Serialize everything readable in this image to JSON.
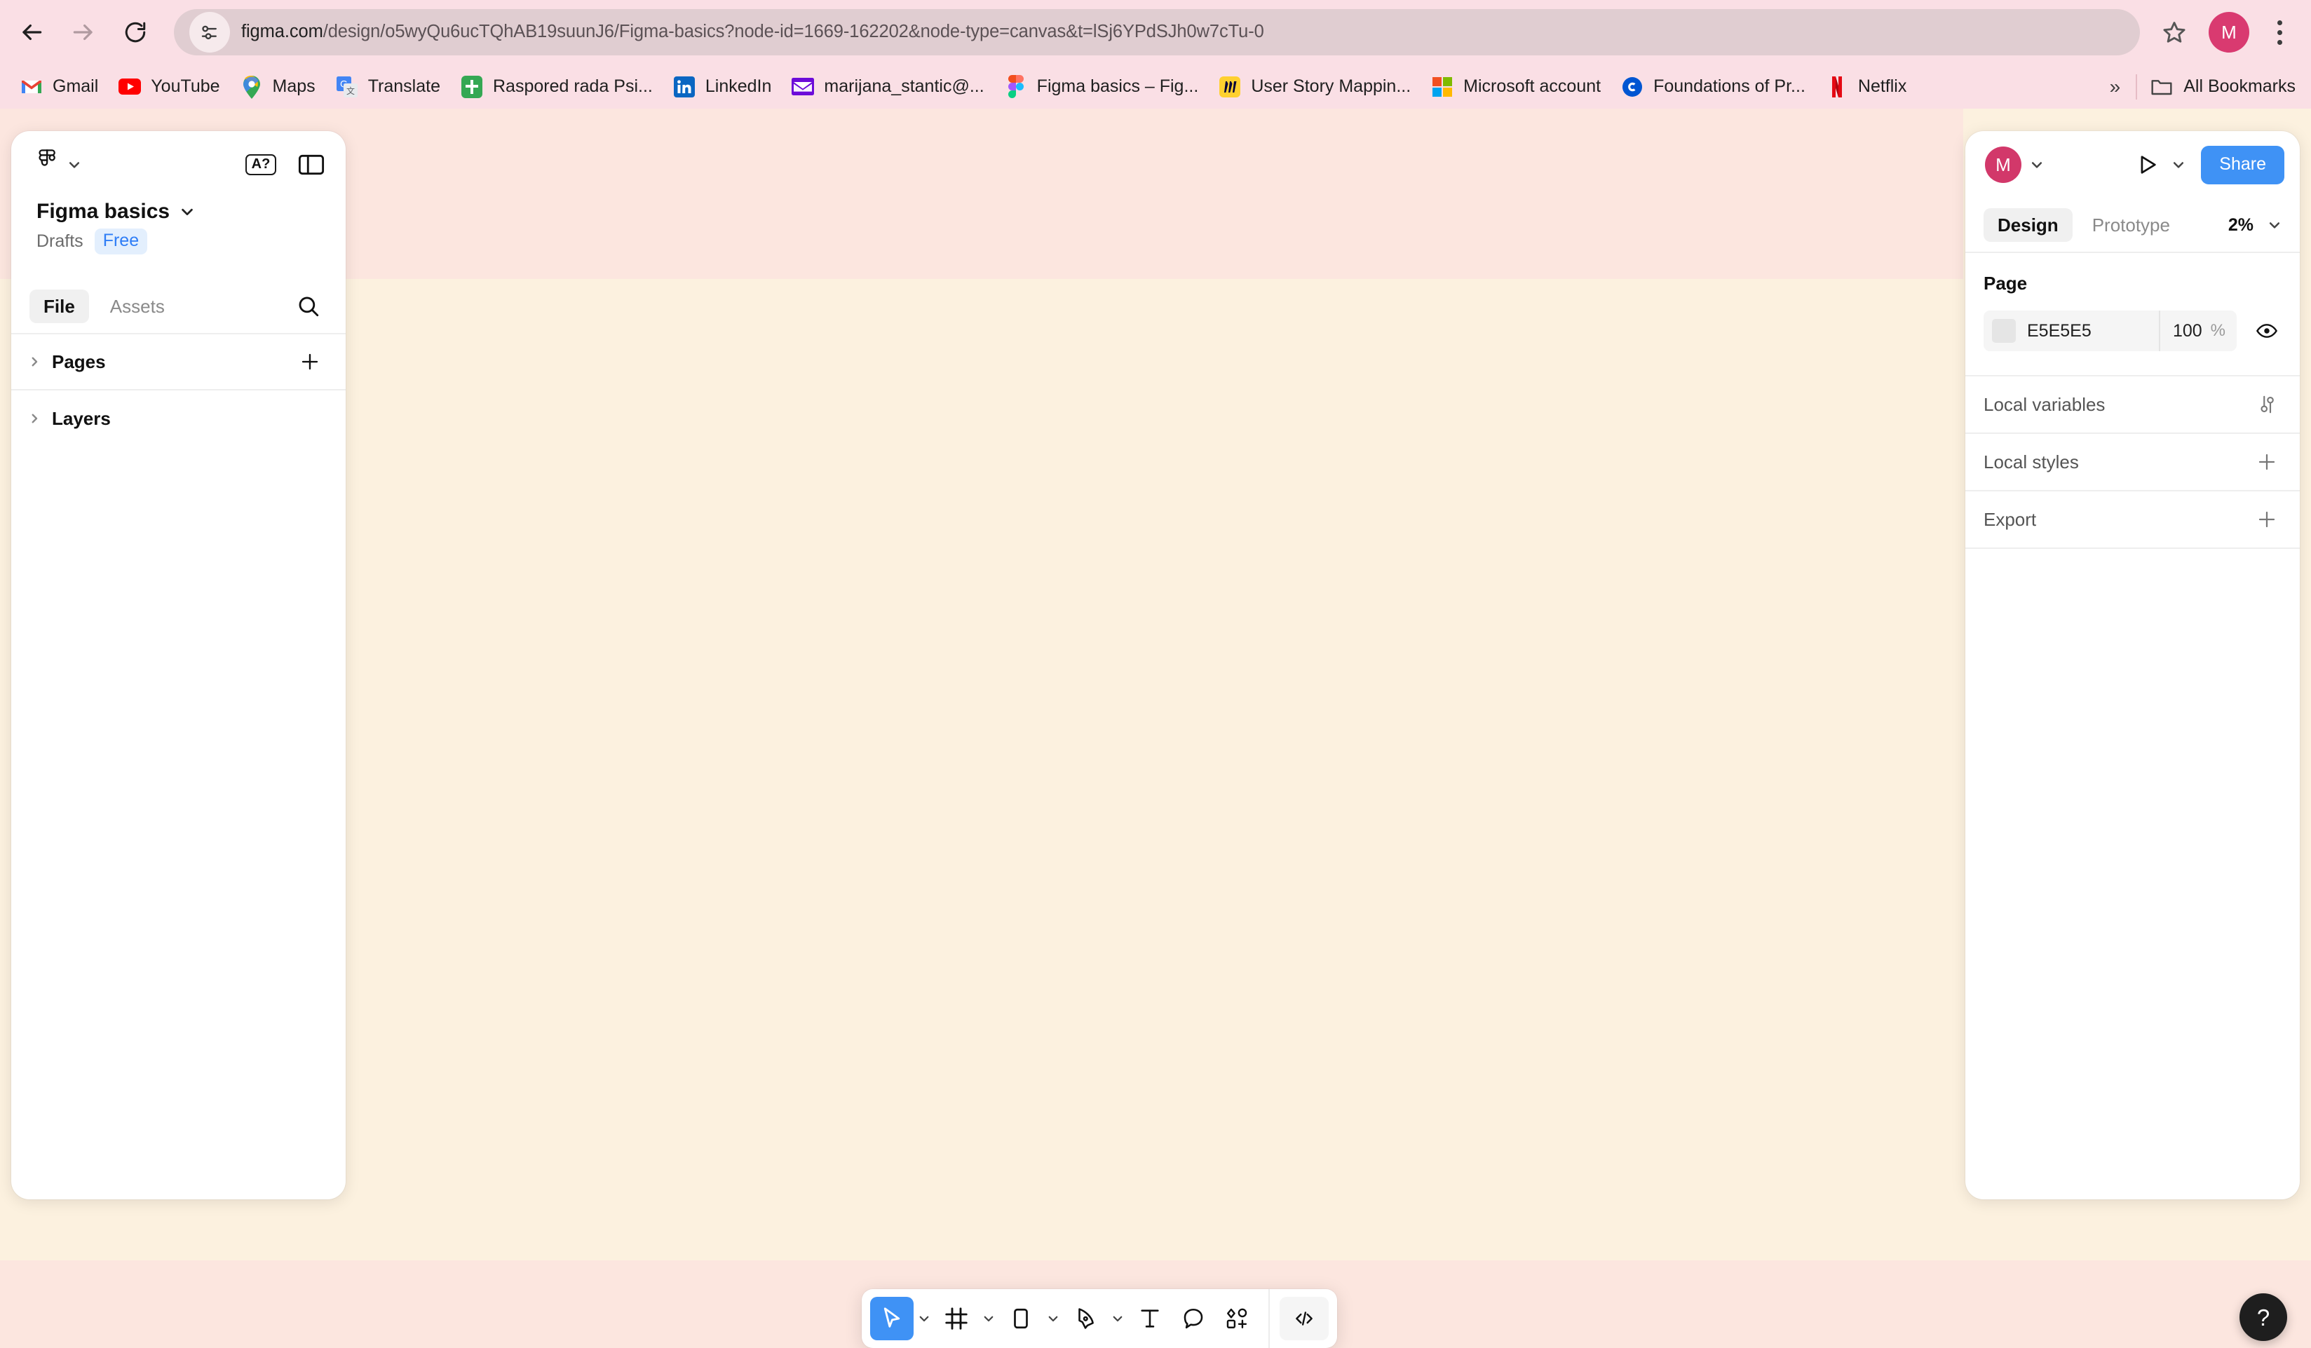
{
  "browser": {
    "nav": {
      "back_label": "Back",
      "forward_label": "Forward",
      "reload_label": "Reload",
      "site_info_label": "View site information"
    },
    "url_prefix": "figma.com",
    "url_rest": "/design/o5wyQu6ucTQhAB19suunJ6/Figma-basics?node-id=1669-162202&node-type=canvas&t=lSj6YPdSJh0w7cTu-0",
    "url_full": "figma.com/design/o5wyQu6ucTQhAB19suunJ6/Figma-basics?node-id=1669-162202&node-type=canvas&t=lSj6YPdSJh0w7cTu-0",
    "bookmark_star_label": "Bookmark this tab",
    "profile_initial": "M",
    "menu_label": "Customize and control Google Chrome",
    "bookmarks": [
      {
        "label": "Gmail",
        "icon": "gmail-icon"
      },
      {
        "label": "YouTube",
        "icon": "youtube-icon"
      },
      {
        "label": "Maps",
        "icon": "google-maps-icon"
      },
      {
        "label": "Translate",
        "icon": "google-translate-icon"
      },
      {
        "label": "Raspored rada Psi...",
        "icon": "green-cross-icon"
      },
      {
        "label": "LinkedIn",
        "icon": "linkedin-icon"
      },
      {
        "label": "marijana_stantic@...",
        "icon": "mail-envelope-icon"
      },
      {
        "label": "Figma basics – Fig...",
        "icon": "figma-icon"
      },
      {
        "label": "User Story Mappin...",
        "icon": "miro-icon"
      },
      {
        "label": "Microsoft account",
        "icon": "microsoft-icon"
      },
      {
        "label": "Foundations of Pr...",
        "icon": "coursera-icon"
      },
      {
        "label": "Netflix",
        "icon": "netflix-icon"
      }
    ],
    "overflow_label": "»",
    "all_bookmarks_label": "All Bookmarks"
  },
  "figma": {
    "left_panel": {
      "logo_label": "Figma",
      "main_menu_caret": "⌄",
      "badge_a_label": "A?",
      "panel_toggle_label": "Toggle panels",
      "file_title": "Figma basics",
      "file_title_caret": "⌄",
      "location": "Drafts",
      "plan_badge": "Free",
      "tabs": [
        {
          "label": "File",
          "active": true
        },
        {
          "label": "Assets",
          "active": false
        }
      ],
      "search_label": "Search",
      "sections": [
        {
          "label": "Pages",
          "action": "add-page"
        },
        {
          "label": "Layers",
          "action": "none"
        }
      ]
    },
    "right_panel": {
      "avatar_initial": "M",
      "avatar_caret": "⌄",
      "present_label": "Present",
      "present_caret": "⌄",
      "share_label": "Share",
      "tabs": [
        {
          "label": "Design",
          "active": true
        },
        {
          "label": "Prototype",
          "active": false
        }
      ],
      "zoom_value": "2%",
      "zoom_caret": "⌄",
      "page_section_title": "Page",
      "page_color_hex": "E5E5E5",
      "page_color_swatch": "#E5E5E5",
      "page_opacity": "100",
      "page_opacity_unit": "%",
      "visibility_label": "Toggle visibility",
      "rows": [
        {
          "label": "Local variables",
          "action_icon": "sliders-icon"
        },
        {
          "label": "Local styles",
          "action_icon": "plus-icon"
        },
        {
          "label": "Export",
          "action_icon": "plus-icon"
        }
      ]
    },
    "toolbar": {
      "tools": [
        {
          "name": "move-tool",
          "icon": "cursor-icon",
          "active": true,
          "caret": true
        },
        {
          "name": "frame-tool",
          "icon": "frame-icon",
          "active": false,
          "caret": true
        },
        {
          "name": "shape-tool",
          "icon": "rectangle-icon",
          "active": false,
          "caret": true
        },
        {
          "name": "pen-tool",
          "icon": "pen-icon",
          "active": false,
          "caret": true
        },
        {
          "name": "text-tool",
          "icon": "text-icon",
          "active": false,
          "caret": false
        },
        {
          "name": "comment-tool",
          "icon": "comment-icon",
          "active": false,
          "caret": false
        },
        {
          "name": "actions-tool",
          "icon": "actions-icon",
          "active": false,
          "caret": false
        }
      ],
      "dev_mode_label": "Dev mode"
    },
    "help_label": "?",
    "canvas": {
      "band_top_color": "#FCE6DF",
      "band_bottom_color": "#FCF1DF"
    }
  }
}
